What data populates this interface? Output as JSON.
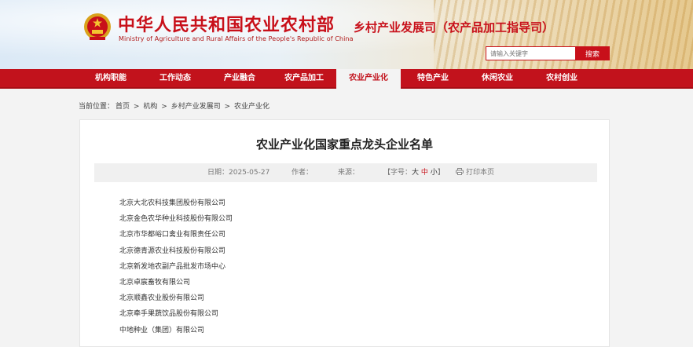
{
  "header": {
    "title_cn": "中华人民共和国农业农村部",
    "title_en": "Ministry of Agriculture and Rural Affairs of the People's Republic of China",
    "department": "乡村产业发展司（农产品加工指导司）",
    "search": {
      "placeholder": "请输入关键字",
      "button_label": "搜索"
    }
  },
  "nav": {
    "items": [
      {
        "label": "机构职能"
      },
      {
        "label": "工作动态"
      },
      {
        "label": "产业融合"
      },
      {
        "label": "农产品加工"
      },
      {
        "label": "农业产业化",
        "active": true
      },
      {
        "label": "特色产业"
      },
      {
        "label": "休闲农业"
      },
      {
        "label": "农村创业"
      }
    ]
  },
  "breadcrumb": {
    "prefix": "当前位置：",
    "items": [
      "首页",
      "机构",
      "乡村产业发展司",
      "农业产业化"
    ],
    "separator": ">"
  },
  "article": {
    "title": "农业产业化国家重点龙头企业名单",
    "meta": {
      "date_label": "日期：2025-05-27",
      "author_label": "作者：",
      "source_label": "来源：",
      "font_size_prefix": "【字号：",
      "font_big": "大",
      "font_mid": "中",
      "font_small": "小",
      "font_size_suffix": "】",
      "print_label": "打印本页"
    },
    "companies": [
      "北京大北农科技集团股份有限公司",
      "北京金色农华种业科技股份有限公司",
      "北京市华都峪口禽业有限责任公司",
      "北京德青源农业科技股份有限公司",
      "北京新发地农副产品批发市场中心",
      "北京卓宸畜牧有限公司",
      "北京顺鑫农业股份有限公司",
      "北京牵手果蔬饮品股份有限公司",
      "中地种业（集团）有限公司"
    ]
  },
  "colors": {
    "brand_red": "#c8101a",
    "nav_red": "#c2121c"
  }
}
